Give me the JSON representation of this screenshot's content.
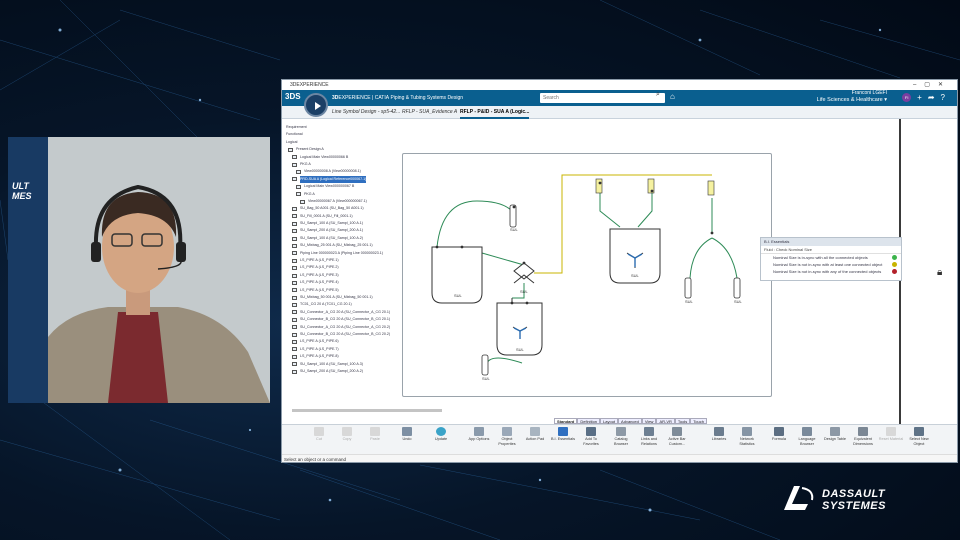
{
  "app": {
    "window_title": "3DEXPERIENCE",
    "brand_bold": "3D",
    "brand_rest": "EXPERIENCE | CATIA",
    "app_name": "Piping & Tubing Systems Design",
    "search_placeholder": "Search",
    "user_info": "Franconi  LGEFI",
    "workspace": "Life Sciences & Healthcare ▾",
    "avatar_initials": "FI"
  },
  "tabs": [
    {
      "label": "Line Symbol Design - sp5-42..."
    },
    {
      "label": "RFLP - SUA_Evidence A"
    },
    {
      "label": "RFLP - P&ID - SUA A (Logic..."
    }
  ],
  "tree": [
    {
      "label": "Requirement"
    },
    {
      "label": "Functional"
    },
    {
      "label": "Logical"
    },
    {
      "label": "Present Design A"
    },
    {
      "label": "Logical Main View00000066 B"
    },
    {
      "label": "PKG A"
    },
    {
      "label": "View00000008 A (View00000008.1)"
    },
    {
      "label": "PRD-SUA A (Logical Reference000067.1)"
    },
    {
      "label": "Logical Main View000000067 B"
    },
    {
      "label": "PKG A"
    },
    {
      "label": "View00000067 A (View000000067.1)"
    },
    {
      "label": "SU_Bag_50 A001 (SU_Bag_50 A001.1)"
    },
    {
      "label": "SU_Fill_0001 A (SU_Fill_0001.1)"
    },
    {
      "label": "SU_Sampl_100 A (SU_Sampl_100 A.1)"
    },
    {
      "label": "SU_Sampl_200 A (SU_Sampl_200 A.1)"
    },
    {
      "label": "SU_Sampl_100 A (SU_Sampl_100 A.2)"
    },
    {
      "label": "SU_Mixbag_25 001 A (SU_Mixbag_25 001.1)"
    },
    {
      "label": "Piping Line 000000023 A (Piping Line 000000023.1)"
    },
    {
      "label": "LS_PIPE A (LS_PIPE.1)"
    },
    {
      "label": "LS_PIPE A (LS_PIPE.2)"
    },
    {
      "label": "LS_PIPE A (LS_PIPE.3)"
    },
    {
      "label": "LS_PIPE A (LS_PIPE.4)"
    },
    {
      "label": "LS_PIPE A (LS_PIPE.5)"
    },
    {
      "label": "SU_Mixbag_50 001 A (SU_Mixbag_50 001.1)"
    },
    {
      "label": "TC01_CG 20 A (TC01_CG 20.1)"
    },
    {
      "label": "SU_Connector_A_CG 20 A (SU_Connector_A_CG 20.1)"
    },
    {
      "label": "SU_Connector_B_CG 20 A (SU_Connector_B_CG 20.1)"
    },
    {
      "label": "SU_Connector_A_CG 20 A (SU_Connector_A_CG 20.2)"
    },
    {
      "label": "SU_Connector_B_CG 20 A (SU_Connector_B_CG 20.2)"
    },
    {
      "label": "LS_PIPE A (LS_PIPE.6)"
    },
    {
      "label": "LS_PIPE A (LS_PIPE.7)"
    },
    {
      "label": "LS_PIPE A (LS_PIPE.8)"
    },
    {
      "label": "SU_Sampl_100 A (SU_Sampl_100 A.3)"
    },
    {
      "label": "SU_Sampl_200 A (SU_Sampl_200 A.2)"
    }
  ],
  "diagram": {
    "labels": [
      "SUL",
      "SUL",
      "SUL",
      "SUL",
      "SUL",
      "SUL",
      "SUL",
      "SUL"
    ]
  },
  "essentials": {
    "title": "B.I. Essentials",
    "filter": "Fluid : Check Nominal Size",
    "legend": [
      {
        "text": "Nominal Size is in-sync with all the connected objects",
        "color": "#3bb34a"
      },
      {
        "text": "Nominal Size is not in-sync with at least one connected object",
        "color": "#c8b400"
      },
      {
        "text": "Nominal Size is not in-sync with any of the connected objects",
        "color": "#b3202a"
      }
    ]
  },
  "ribbon_tabs": [
    "Standard",
    "Definition",
    "Layout",
    "Advanced",
    "View",
    "AR-VR",
    "Tools",
    "Touch"
  ],
  "ribbon_tools": [
    {
      "label": "Cut"
    },
    {
      "label": "Copy"
    },
    {
      "label": "Paste"
    },
    {
      "label": "Undo"
    },
    {
      "label": "Update"
    },
    {
      "label": "App Options"
    },
    {
      "label": "Object Properties"
    },
    {
      "label": "Action Pad"
    },
    {
      "label": "B.I. Essentials"
    },
    {
      "label": "Add To Favorites"
    },
    {
      "label": "Catalog Browser"
    },
    {
      "label": "Links and Relations"
    },
    {
      "label": "Active Bar Custom..."
    },
    {
      "label": "Libraries"
    },
    {
      "label": "Network Statistics"
    },
    {
      "label": "Formula"
    },
    {
      "label": "Language Browser"
    },
    {
      "label": "Design Table"
    },
    {
      "label": "Equivalent Dimensions"
    },
    {
      "label": "Reset Material"
    },
    {
      "label": "Select New Object"
    }
  ],
  "status": "Select an object or a command",
  "corporate": {
    "line1": "DASSAULT",
    "line2": "SYSTEMES"
  },
  "cam_logo": {
    "line1": "ULT",
    "line2": "MES"
  }
}
